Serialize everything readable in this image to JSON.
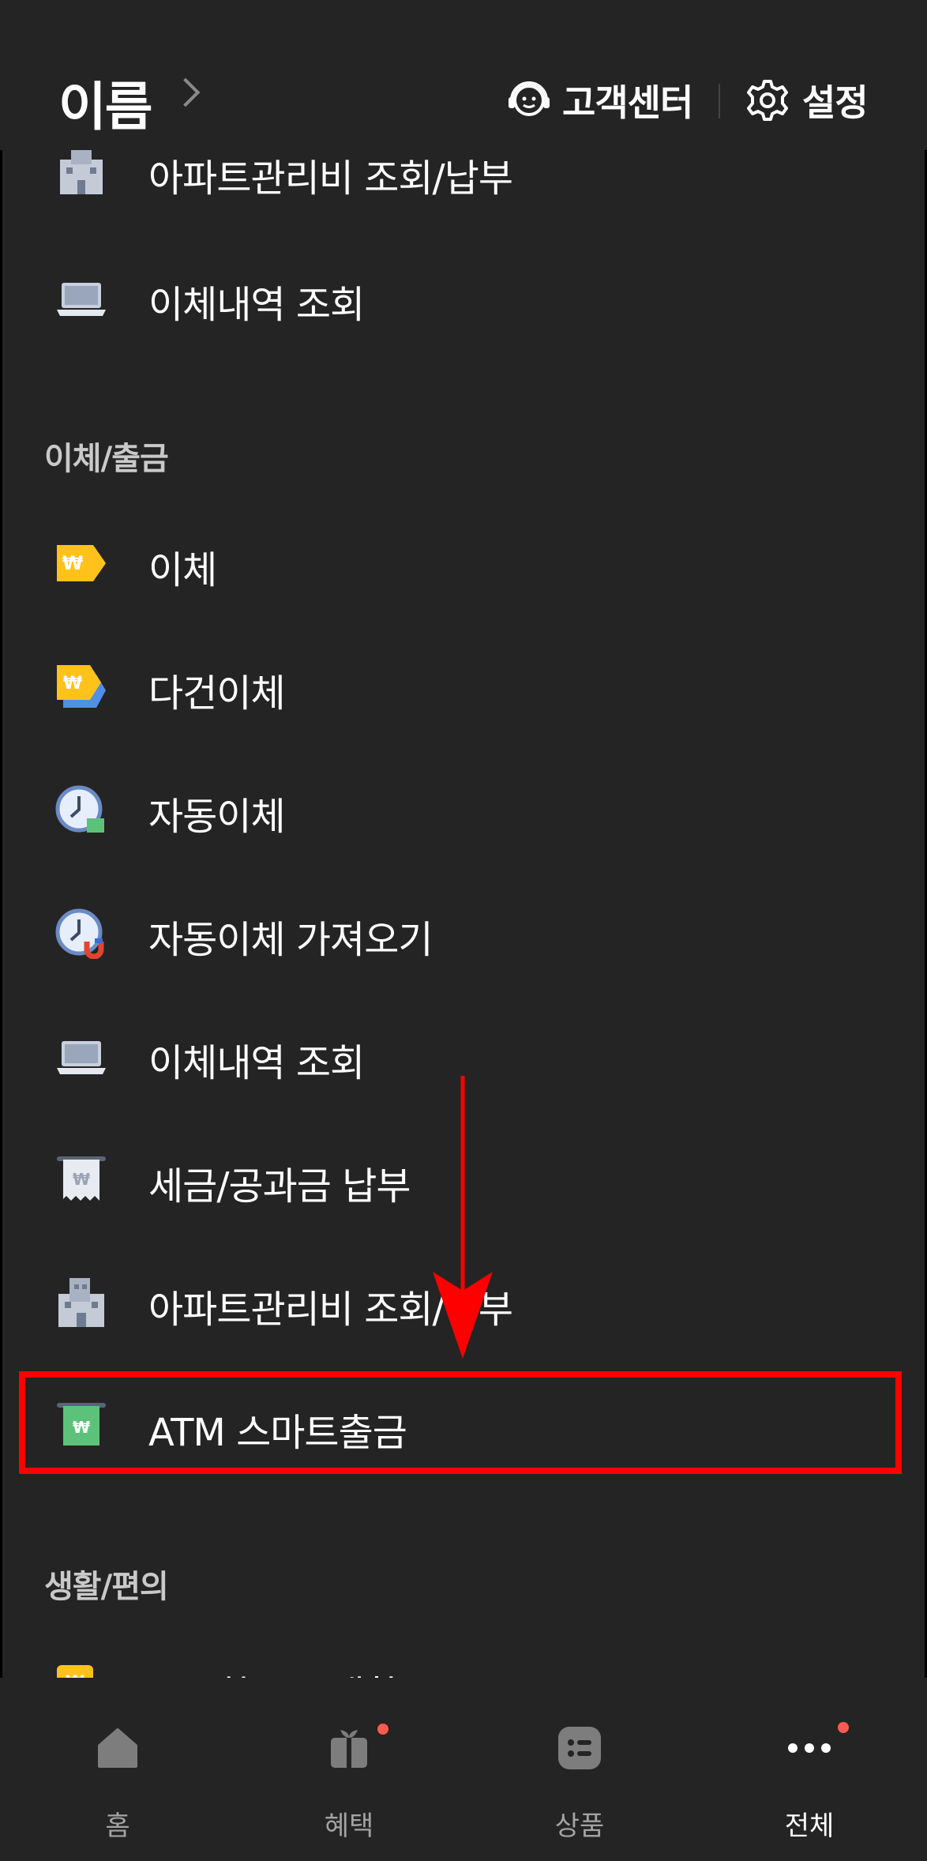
{
  "header": {
    "name": "이름",
    "customer_center": "고객센터",
    "settings": "설정"
  },
  "partial_row": {
    "label": "아파트관리비 조회/납부",
    "icon": "apartment-building-icon"
  },
  "top_rows": [
    {
      "label": "이체내역 조회",
      "icon": "laptop-icon"
    }
  ],
  "sections": [
    {
      "title": "이체/출금",
      "items": [
        {
          "label": "이체",
          "icon": "won-tag-icon"
        },
        {
          "label": "다건이체",
          "icon": "multi-won-tag-icon"
        },
        {
          "label": "자동이체",
          "icon": "clock-icon"
        },
        {
          "label": "자동이체 가져오기",
          "icon": "clock-magnet-icon"
        },
        {
          "label": "이체내역 조회",
          "icon": "laptop-icon"
        },
        {
          "label": "세금/공과금 납부",
          "icon": "receipt-icon"
        },
        {
          "label": "아파트관리비 조회/납부",
          "icon": "apartment-building-icon"
        },
        {
          "label": "ATM 스마트출금",
          "icon": "atm-cash-icon"
        }
      ]
    },
    {
      "title": "생활/편의",
      "items": [
        {
          "label": "똑똑한 구독생활",
          "icon": "subscription-icon"
        }
      ]
    }
  ],
  "annotation": {
    "highlighted_item": "ATM 스마트출금",
    "highlight_color": "#ff0000"
  },
  "bottom_nav": [
    {
      "label": "홈",
      "icon": "home-icon",
      "active": false,
      "badge": false
    },
    {
      "label": "혜택",
      "icon": "gift-icon",
      "active": false,
      "badge": true
    },
    {
      "label": "상품",
      "icon": "list-icon",
      "active": false,
      "badge": false
    },
    {
      "label": "전체",
      "icon": "more-icon",
      "active": true,
      "badge": true
    }
  ],
  "colors": {
    "background": "#242424",
    "text": "#ffffff",
    "section_title": "#c9c9c9",
    "badge": "#ff5a4f",
    "accent_yellow": "#ffc21a"
  }
}
